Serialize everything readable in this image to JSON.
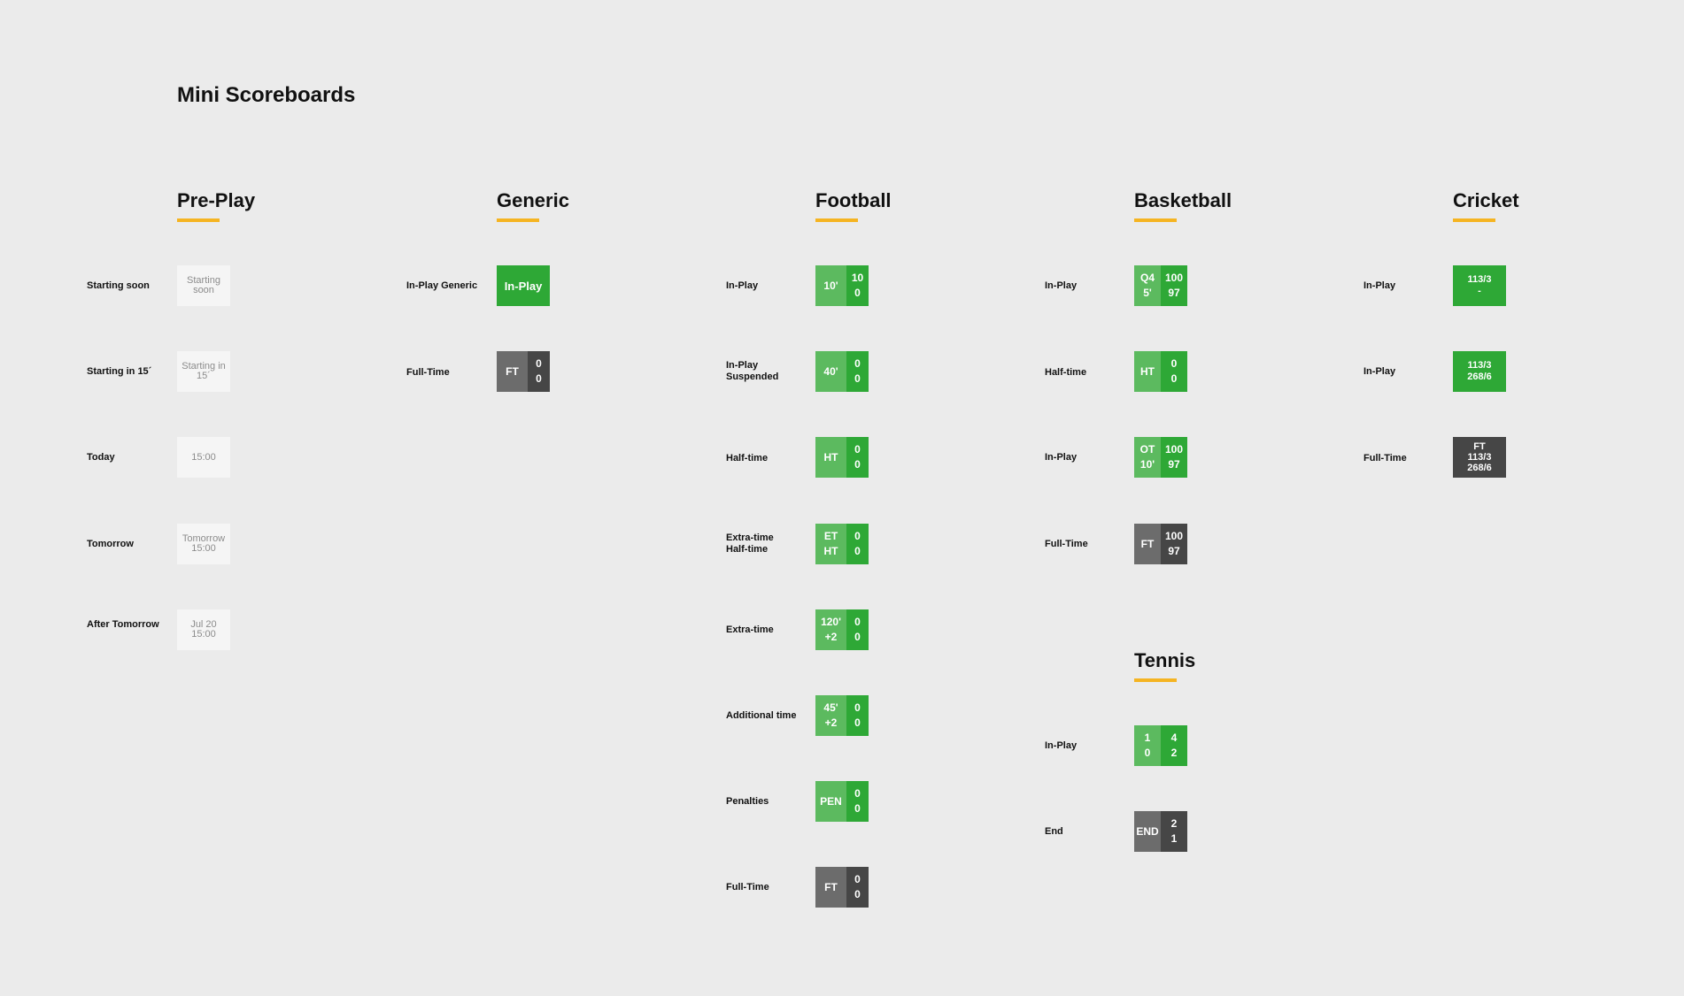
{
  "page": {
    "title": "Mini Scoreboards",
    "accent": "#f5b422"
  },
  "sections": {
    "preplay": "Pre-Play",
    "generic": "Generic",
    "football": "Football",
    "basketball": "Basketball",
    "cricket": "Cricket",
    "tennis": "Tennis"
  },
  "preplay": [
    {
      "label": "Starting soon",
      "l1": "Starting",
      "l2": "soon"
    },
    {
      "label": "Starting in 15´",
      "l1": "Starting in",
      "l2": "15´"
    },
    {
      "label": "Today",
      "l1": "15:00",
      "l2": ""
    },
    {
      "label": "Tomorrow",
      "l1": "Tomorrow",
      "l2": "15:00"
    },
    {
      "label": "After Tomorrow",
      "l1": "Jul 20",
      "l2": "15:00"
    }
  ],
  "generic": [
    {
      "label": "In-Play Generic",
      "text": "In-Play"
    },
    {
      "label": "Full-Time",
      "status": "FT",
      "s1": "0",
      "s2": "0"
    }
  ],
  "football": [
    {
      "label1": "In-Play",
      "label2": "",
      "st1": "10'",
      "st2": "",
      "s1": "10",
      "s2": "0"
    },
    {
      "label1": "In-Play",
      "label2": "Suspended",
      "st1": "40'",
      "st2": "",
      "s1": "0",
      "s2": "0"
    },
    {
      "label1": "Half-time",
      "label2": "",
      "st1": "HT",
      "st2": "",
      "s1": "0",
      "s2": "0"
    },
    {
      "label1": "Extra-time",
      "label2": "Half-time",
      "st1": "ET",
      "st2": "HT",
      "s1": "0",
      "s2": "0"
    },
    {
      "label1": "Extra-time",
      "label2": "",
      "st1": "120'",
      "st2": "+2",
      "s1": "0",
      "s2": "0"
    },
    {
      "label1": "Additional time",
      "label2": "",
      "st1": "45'",
      "st2": "+2",
      "s1": "0",
      "s2": "0"
    },
    {
      "label1": "Penalties",
      "label2": "",
      "st1": "PEN",
      "st2": "",
      "s1": "0",
      "s2": "0"
    },
    {
      "label1": "Full-Time",
      "label2": "",
      "st1": "FT",
      "st2": "",
      "s1": "0",
      "s2": "0"
    }
  ],
  "basketball": [
    {
      "label": "In-Play",
      "st1": "Q4",
      "st2": "5'",
      "s1": "100",
      "s2": "97"
    },
    {
      "label": "Half-time",
      "st1": "HT",
      "st2": "",
      "s1": "0",
      "s2": "0"
    },
    {
      "label": "In-Play",
      "st1": "OT",
      "st2": "10'",
      "s1": "100",
      "s2": "97"
    },
    {
      "label": "Full-Time",
      "st1": "FT",
      "st2": "",
      "s1": "100",
      "s2": "97"
    }
  ],
  "tennis": [
    {
      "label": "In-Play",
      "st1": "1",
      "st2": "0",
      "s1": "4",
      "s2": "2"
    },
    {
      "label": "End",
      "st1": "END",
      "st2": "",
      "s1": "2",
      "s2": "1"
    }
  ],
  "cricket": [
    {
      "label": "In-Play",
      "l1": "113/3",
      "l2": "-",
      "l3": ""
    },
    {
      "label": "In-Play",
      "l1": "113/3",
      "l2": "268/6",
      "l3": ""
    },
    {
      "label": "Full-Time",
      "l1": "FT",
      "l2": "113/3",
      "l3": "268/6"
    }
  ]
}
